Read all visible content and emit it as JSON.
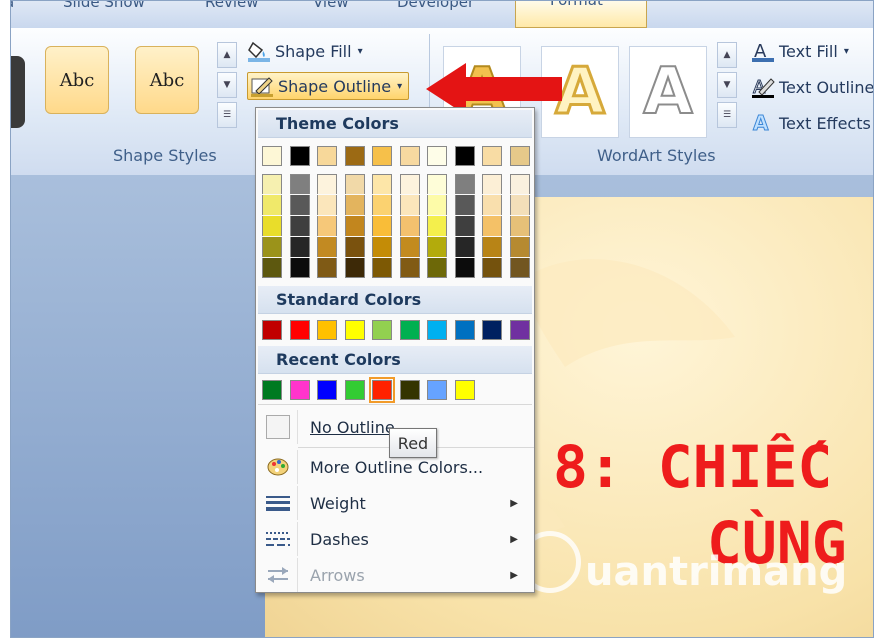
{
  "ribbon": {
    "tabs": [
      "Slide Show",
      "Review",
      "View",
      "Developer",
      "Format"
    ],
    "active_tab": "Format",
    "shape_styles": {
      "thumbs": [
        "Abc",
        "Abc"
      ],
      "label": "Shape Styles"
    },
    "commands": {
      "shape_fill": "Shape Fill",
      "shape_outline": "Shape Outline",
      "text_fill": "Text Fill",
      "text_outline": "Text Outline",
      "text_effects": "Text Effects"
    },
    "wordart": {
      "label": "WordArt Styles",
      "letters": [
        "A",
        "A",
        "A"
      ]
    }
  },
  "menu": {
    "theme_header": "Theme Colors",
    "standard_header": "Standard Colors",
    "recent_header": "Recent Colors",
    "theme_top": [
      "#fdf7d6",
      "#000000",
      "#f7d89a",
      "#9c6a14",
      "#f6c04a",
      "#f7d9a0",
      "#fefde8",
      "#000000",
      "#f8dca4",
      "#e6c98a"
    ],
    "theme_shades": [
      [
        "#f6f0b0",
        "#f0e96a",
        "#e9dd2a",
        "#9b931a",
        "#5d580f"
      ],
      [
        "#7f7f7f",
        "#595959",
        "#3f3f3f",
        "#262626",
        "#0c0c0c"
      ],
      [
        "#fdf3dd",
        "#fbe6bb",
        "#f6c879",
        "#c28a22",
        "#7f5a15"
      ],
      [
        "#f1d9a8",
        "#e3b45e",
        "#c2861e",
        "#7a520e",
        "#3d2907"
      ],
      [
        "#fde6a8",
        "#fbd270",
        "#f9bd38",
        "#c48c06",
        "#7d5904"
      ],
      [
        "#fdf3dd",
        "#fbe6bb",
        "#f3c16e",
        "#c38b1f",
        "#815b14"
      ],
      [
        "#fefdd8",
        "#fdfba8",
        "#f4ef4c",
        "#b3ab0c",
        "#6d6808"
      ],
      [
        "#7f7f7f",
        "#595959",
        "#3f3f3f",
        "#262626",
        "#0c0c0c"
      ],
      [
        "#fcefd6",
        "#f9dfad",
        "#f4c167",
        "#b88416",
        "#74520d"
      ],
      [
        "#faf1df",
        "#f3dfb9",
        "#e6c078",
        "#b68a31",
        "#725620"
      ]
    ],
    "standard_colors": [
      "#c00000",
      "#ff0000",
      "#ffc000",
      "#ffff00",
      "#92d050",
      "#00b050",
      "#00b0f0",
      "#0070c0",
      "#002060",
      "#7030a0"
    ],
    "recent_colors": [
      "#007a20",
      "#ff33cc",
      "#0000ff",
      "#33cc33",
      "#ff2200",
      "#333300",
      "#66a3ff",
      "#ffff00"
    ],
    "items": {
      "no_outline": "No Outline",
      "more_colors": "More Outline Colors...",
      "weight": "Weight",
      "dashes": "Dashes",
      "arrows": "Arrows"
    },
    "tooltip": "Red"
  },
  "slide": {
    "title_line1": "8: CHIẾC",
    "title_line2": "CÙNG",
    "watermark": "uantrimang"
  }
}
